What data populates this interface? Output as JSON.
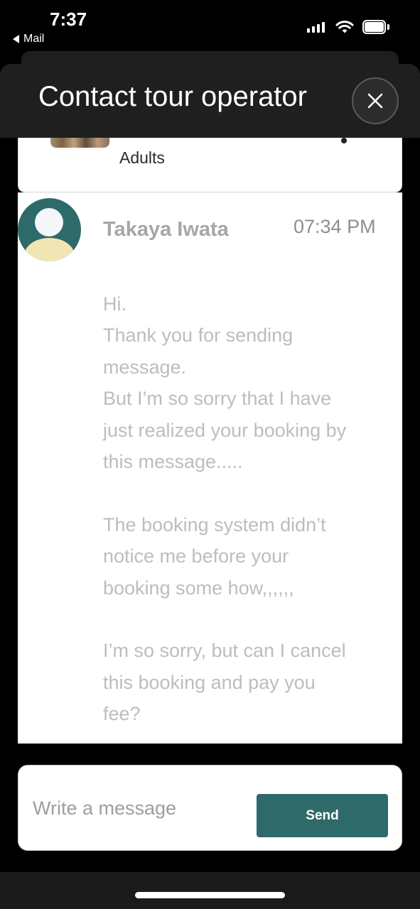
{
  "status_bar": {
    "time": "7:37",
    "back_label": "Mail"
  },
  "header": {
    "title": "Contact tour operator"
  },
  "booking_card": {
    "guests_label": "Adults"
  },
  "message": {
    "sender": "Takaya Iwata",
    "time": "07:34 PM",
    "lines": [
      "Hi.",
      "Thank you for sending",
      "message.",
      "But I’m so sorry that I have",
      "just realized your booking by",
      "this message.....",
      "The booking system didn’t",
      "notice me before your",
      "booking some how,,,,,,",
      "I’m so sorry, but can I cancel",
      "this booking and pay you",
      "fee?"
    ]
  },
  "composer": {
    "placeholder": "Write a message",
    "send_label": "Send"
  },
  "colors": {
    "accent": "#2f6a6a",
    "header_bg": "#1f1f1f",
    "message_text": "#bdbdbd"
  },
  "icons": {
    "close": "close-icon",
    "back": "back-triangle-icon"
  }
}
